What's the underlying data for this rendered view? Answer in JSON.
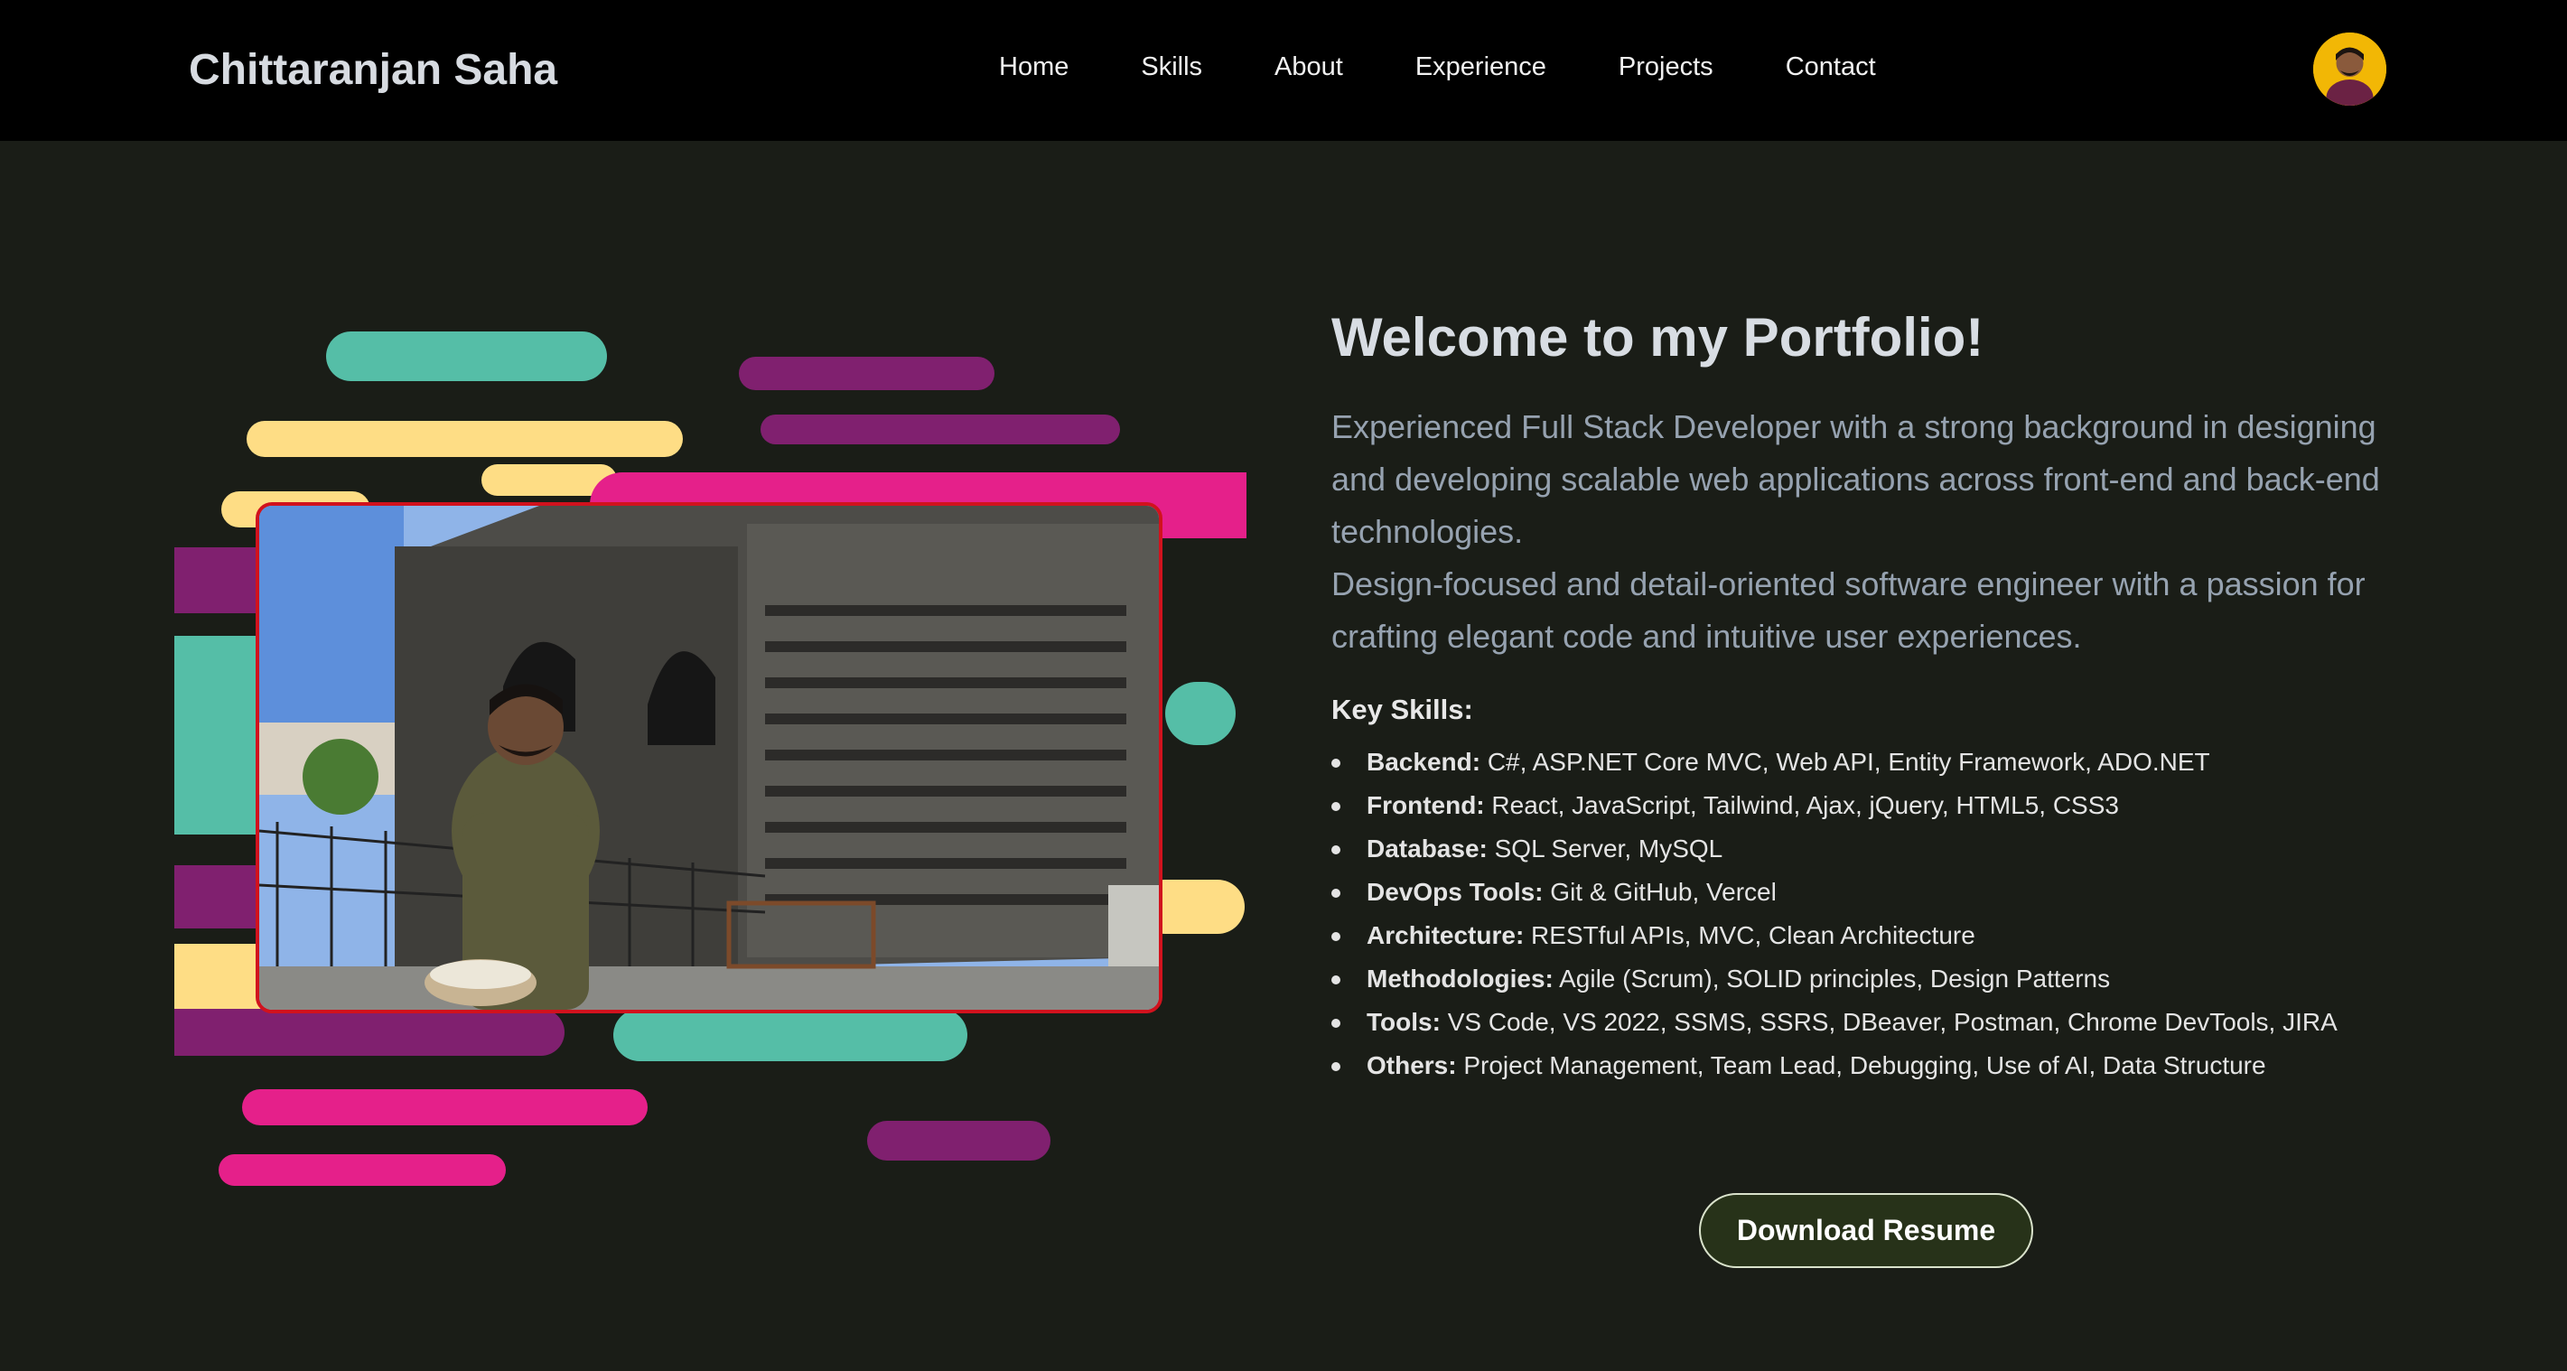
{
  "brand": "Chittaranjan Saha",
  "nav": [
    {
      "label": "Home"
    },
    {
      "label": "Skills"
    },
    {
      "label": "About"
    },
    {
      "label": "Experience"
    },
    {
      "label": "Projects"
    },
    {
      "label": "Contact"
    }
  ],
  "hero": {
    "title": "Welcome to my Portfolio!",
    "description_1": "Experienced Full Stack Developer with a strong background in designing and developing scalable web applications across front-end and back-end technologies.",
    "description_2": "Design-focused and detail-oriented software engineer with a passion for crafting elegant code and intuitive user experiences."
  },
  "skills": {
    "heading": "Key Skills:",
    "items": [
      {
        "label": "Backend:",
        "value": "C#, ASP.NET Core MVC, Web API, Entity Framework, ADO.NET"
      },
      {
        "label": "Frontend:",
        "value": "React, JavaScript, Tailwind, Ajax, jQuery, HTML5, CSS3"
      },
      {
        "label": "Database:",
        "value": "SQL Server, MySQL"
      },
      {
        "label": "DevOps Tools:",
        "value": "Git & GitHub, Vercel"
      },
      {
        "label": "Architecture:",
        "value": "RESTful APIs, MVC, Clean Architecture"
      },
      {
        "label": "Methodologies:",
        "value": "Agile (Scrum), SOLID principles, Design Patterns"
      },
      {
        "label": "Tools:",
        "value": "VS Code, VS 2022, SSMS, SSRS, DBeaver, Postman, Chrome DevTools, JIRA"
      },
      {
        "label": "Others:",
        "value": "Project Management, Team Lead, Debugging, Use of AI, Data Structure"
      }
    ]
  },
  "cta": {
    "label": "Download Resume"
  },
  "colors": {
    "background": "#1a1d17",
    "navbar": "#000000",
    "teal": "#55bea7",
    "yellow": "#fedd85",
    "magenta": "#80206f",
    "pink": "#e5208a",
    "photo_border": "#d1121d",
    "button_bg": "#273219"
  }
}
